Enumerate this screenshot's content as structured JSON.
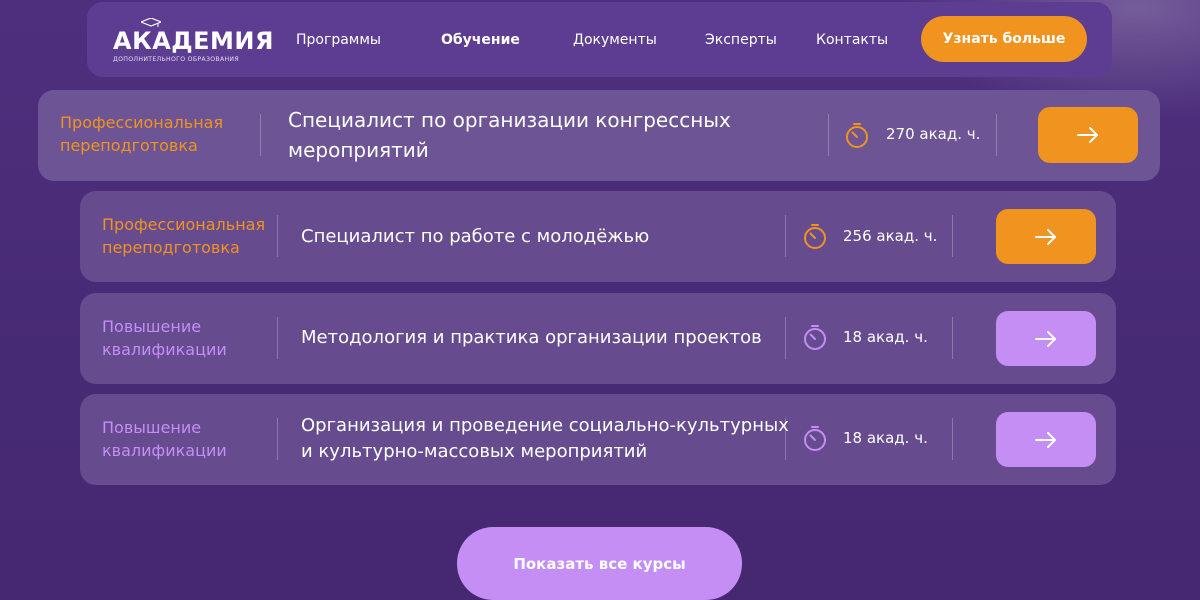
{
  "logo": {
    "title": "АКАДЕМИЯ",
    "subtitle": "ДОПОЛНИТЕЛЬНОГО ОБРАЗОВАНИЯ"
  },
  "nav": {
    "items": [
      {
        "label": "Программы",
        "active": false
      },
      {
        "label": "Обучение",
        "active": true
      },
      {
        "label": "Документы",
        "active": false
      },
      {
        "label": "Эксперты",
        "active": false
      },
      {
        "label": "Контакты",
        "active": false
      }
    ],
    "cta_label": "Узнать больше"
  },
  "courses": [
    {
      "category": "Профессиональная\nпереподготовка",
      "title": "Специалист по организации конгрессных\nмероприятий",
      "hours": "270 акад. ч."
    },
    {
      "category": "Профессиональная\nпереподготовка",
      "title": "Специалист по работе с молодёжью",
      "hours": "256 акад. ч."
    },
    {
      "category": "Повышение\nквалификации",
      "title": "Методология и практика организации проектов",
      "hours": "18 акад. ч."
    },
    {
      "category": "Повышение\nквалификации",
      "title": "Организация и проведение социально-культурных\nи культурно-массовых мероприятий",
      "hours": "18 акад. ч."
    }
  ],
  "show_all_label": "Показать все курсы",
  "icons": {
    "timer": "stopwatch-icon",
    "arrow": "arrow-right-icon",
    "cap": "graduation-cap-icon"
  },
  "colors": {
    "background": "#4e2f7e",
    "header": "#5d3d91",
    "accent_orange": "#f0931f",
    "accent_violet": "#c48ef5"
  }
}
